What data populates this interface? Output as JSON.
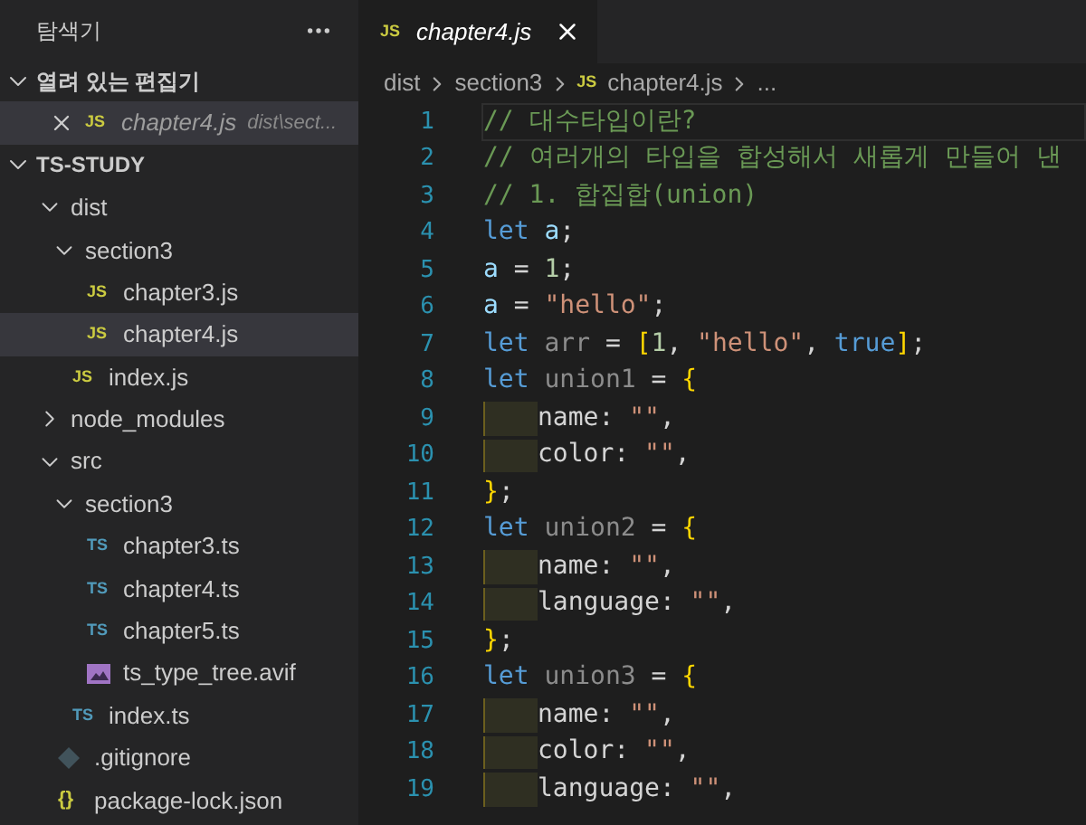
{
  "sidebar": {
    "title": "탐색기",
    "open_editors": {
      "label": "열려 있는 편집기",
      "expanded": true,
      "items": [
        {
          "name": "chapter4.js",
          "path": "dist\\sect...",
          "kind": "js",
          "icon_label": "JS",
          "selected": true
        }
      ]
    },
    "workspace": {
      "label": "TS-STUDY",
      "expanded": true,
      "tree": [
        {
          "name": "dist",
          "kind": "folder",
          "expanded": true,
          "selected": false,
          "children": [
            {
              "name": "section3",
              "kind": "folder",
              "expanded": true,
              "selected": false,
              "children": [
                {
                  "name": "chapter3.js",
                  "kind": "js",
                  "icon_label": "JS",
                  "selected": false
                },
                {
                  "name": "chapter4.js",
                  "kind": "js",
                  "icon_label": "JS",
                  "selected": true
                }
              ]
            },
            {
              "name": "index.js",
              "kind": "js",
              "icon_label": "JS",
              "selected": false
            }
          ]
        },
        {
          "name": "node_modules",
          "kind": "folder",
          "expanded": false,
          "selected": false
        },
        {
          "name": "src",
          "kind": "folder",
          "expanded": true,
          "selected": false,
          "children": [
            {
              "name": "section3",
              "kind": "folder",
              "expanded": true,
              "selected": false,
              "children": [
                {
                  "name": "chapter3.ts",
                  "kind": "ts",
                  "icon_label": "TS",
                  "selected": false
                },
                {
                  "name": "chapter4.ts",
                  "kind": "ts",
                  "icon_label": "TS",
                  "selected": false
                },
                {
                  "name": "chapter5.ts",
                  "kind": "ts",
                  "icon_label": "TS",
                  "selected": false
                },
                {
                  "name": "ts_type_tree.avif",
                  "kind": "image",
                  "selected": false
                }
              ]
            },
            {
              "name": "index.ts",
              "kind": "ts",
              "icon_label": "TS",
              "selected": false
            }
          ]
        },
        {
          "name": ".gitignore",
          "kind": "git",
          "selected": false
        },
        {
          "name": "package-lock.json",
          "kind": "json",
          "icon_label": "{}",
          "selected": false
        }
      ]
    }
  },
  "tabs": [
    {
      "label": "chapter4.js",
      "icon_label": "JS",
      "selected": true,
      "preview": true
    }
  ],
  "breadcrumb": [
    {
      "label": "dist"
    },
    {
      "label": "section3"
    },
    {
      "label": "chapter4.js",
      "icon_label": "JS"
    },
    {
      "label": "..."
    }
  ],
  "code": [
    {
      "line_number": "1",
      "current": true,
      "indent": false,
      "tokens": [
        {
          "text": "// 대수타입이란?",
          "kind": "comment"
        }
      ]
    },
    {
      "line_number": "2",
      "current": false,
      "indent": false,
      "tokens": [
        {
          "text": "// 여러개의 타입을 합성해서 새롭게 만들어 낸",
          "kind": "comment"
        }
      ]
    },
    {
      "line_number": "3",
      "current": false,
      "indent": false,
      "tokens": [
        {
          "text": "// 1. 합집합(union)",
          "kind": "comment"
        }
      ]
    },
    {
      "line_number": "4",
      "current": false,
      "indent": false,
      "tokens": [
        {
          "text": "let",
          "kind": "keyword"
        },
        {
          "text": " a",
          "kind": "var"
        },
        {
          "text": ";",
          "kind": "punct"
        }
      ]
    },
    {
      "line_number": "5",
      "current": false,
      "indent": false,
      "tokens": [
        {
          "text": "a",
          "kind": "var"
        },
        {
          "text": " = ",
          "kind": "punct"
        },
        {
          "text": "1",
          "kind": "number"
        },
        {
          "text": ";",
          "kind": "punct"
        }
      ]
    },
    {
      "line_number": "6",
      "current": false,
      "indent": false,
      "tokens": [
        {
          "text": "a",
          "kind": "var"
        },
        {
          "text": " = ",
          "kind": "punct"
        },
        {
          "text": "\"hello\"",
          "kind": "string"
        },
        {
          "text": ";",
          "kind": "punct"
        }
      ]
    },
    {
      "line_number": "7",
      "current": false,
      "indent": false,
      "tokens": [
        {
          "text": "let",
          "kind": "keyword"
        },
        {
          "text": " arr",
          "kind": "unused"
        },
        {
          "text": " = ",
          "kind": "punct"
        },
        {
          "text": "[",
          "kind": "brace"
        },
        {
          "text": "1",
          "kind": "number"
        },
        {
          "text": ", ",
          "kind": "punct"
        },
        {
          "text": "\"hello\"",
          "kind": "string"
        },
        {
          "text": ", ",
          "kind": "punct"
        },
        {
          "text": "true",
          "kind": "keyword"
        },
        {
          "text": "]",
          "kind": "brace"
        },
        {
          "text": ";",
          "kind": "punct"
        }
      ]
    },
    {
      "line_number": "8",
      "current": false,
      "indent": false,
      "tokens": [
        {
          "text": "let",
          "kind": "keyword"
        },
        {
          "text": " union1",
          "kind": "unused"
        },
        {
          "text": " = ",
          "kind": "punct"
        },
        {
          "text": "{",
          "kind": "brace"
        }
      ]
    },
    {
      "line_number": "9",
      "current": false,
      "indent": true,
      "tokens": [
        {
          "text": "name",
          "kind": "prop"
        },
        {
          "text": ": ",
          "kind": "punct"
        },
        {
          "text": "\"\"",
          "kind": "string"
        },
        {
          "text": ",",
          "kind": "punct"
        }
      ]
    },
    {
      "line_number": "10",
      "current": false,
      "indent": true,
      "tokens": [
        {
          "text": "color",
          "kind": "prop"
        },
        {
          "text": ": ",
          "kind": "punct"
        },
        {
          "text": "\"\"",
          "kind": "string"
        },
        {
          "text": ",",
          "kind": "punct"
        }
      ]
    },
    {
      "line_number": "11",
      "current": false,
      "indent": false,
      "tokens": [
        {
          "text": "}",
          "kind": "brace"
        },
        {
          "text": ";",
          "kind": "punct"
        }
      ]
    },
    {
      "line_number": "12",
      "current": false,
      "indent": false,
      "tokens": [
        {
          "text": "let",
          "kind": "keyword"
        },
        {
          "text": " union2",
          "kind": "unused"
        },
        {
          "text": " = ",
          "kind": "punct"
        },
        {
          "text": "{",
          "kind": "brace"
        }
      ]
    },
    {
      "line_number": "13",
      "current": false,
      "indent": true,
      "tokens": [
        {
          "text": "name",
          "kind": "prop"
        },
        {
          "text": ": ",
          "kind": "punct"
        },
        {
          "text": "\"\"",
          "kind": "string"
        },
        {
          "text": ",",
          "kind": "punct"
        }
      ]
    },
    {
      "line_number": "14",
      "current": false,
      "indent": true,
      "tokens": [
        {
          "text": "language",
          "kind": "prop"
        },
        {
          "text": ": ",
          "kind": "punct"
        },
        {
          "text": "\"\"",
          "kind": "string"
        },
        {
          "text": ",",
          "kind": "punct"
        }
      ]
    },
    {
      "line_number": "15",
      "current": false,
      "indent": false,
      "tokens": [
        {
          "text": "}",
          "kind": "brace"
        },
        {
          "text": ";",
          "kind": "punct"
        }
      ]
    },
    {
      "line_number": "16",
      "current": false,
      "indent": false,
      "tokens": [
        {
          "text": "let",
          "kind": "keyword"
        },
        {
          "text": " union3",
          "kind": "unused"
        },
        {
          "text": " = ",
          "kind": "punct"
        },
        {
          "text": "{",
          "kind": "brace"
        }
      ]
    },
    {
      "line_number": "17",
      "current": false,
      "indent": true,
      "tokens": [
        {
          "text": "name",
          "kind": "prop"
        },
        {
          "text": ": ",
          "kind": "punct"
        },
        {
          "text": "\"\"",
          "kind": "string"
        },
        {
          "text": ",",
          "kind": "punct"
        }
      ]
    },
    {
      "line_number": "18",
      "current": false,
      "indent": true,
      "tokens": [
        {
          "text": "color",
          "kind": "prop"
        },
        {
          "text": ": ",
          "kind": "punct"
        },
        {
          "text": "\"\"",
          "kind": "string"
        },
        {
          "text": ",",
          "kind": "punct"
        }
      ]
    },
    {
      "line_number": "19",
      "current": false,
      "indent": true,
      "tokens": [
        {
          "text": "language",
          "kind": "prop"
        },
        {
          "text": ": ",
          "kind": "punct"
        },
        {
          "text": "\"\"",
          "kind": "string"
        },
        {
          "text": ",",
          "kind": "punct"
        }
      ]
    }
  ]
}
